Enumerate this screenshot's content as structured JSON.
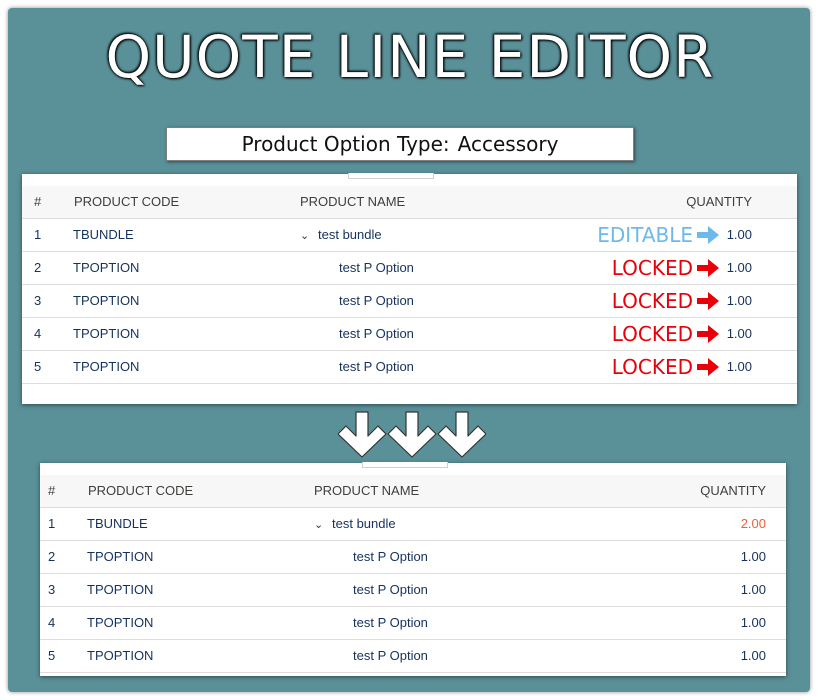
{
  "title": "QUOTE LINE EDITOR",
  "option_type": {
    "label": "Product Option Type:",
    "value": "Accessory"
  },
  "columns": {
    "num": "#",
    "code": "PRODUCT CODE",
    "name": "PRODUCT NAME",
    "qty": "QUANTITY"
  },
  "before": {
    "rows": [
      {
        "num": "1",
        "code": "TBUNDLE",
        "name": "test bundle",
        "qty": "1.00",
        "status": "EDITABLE"
      },
      {
        "num": "2",
        "code": "TPOPTION",
        "name": "test P Option",
        "qty": "1.00",
        "status": "LOCKED"
      },
      {
        "num": "3",
        "code": "TPOPTION",
        "name": "test P Option",
        "qty": "1.00",
        "status": "LOCKED"
      },
      {
        "num": "4",
        "code": "TPOPTION",
        "name": "test P Option",
        "qty": "1.00",
        "status": "LOCKED"
      },
      {
        "num": "5",
        "code": "TPOPTION",
        "name": "test P Option",
        "qty": "1.00",
        "status": "LOCKED"
      }
    ]
  },
  "after": {
    "rows": [
      {
        "num": "1",
        "code": "TBUNDLE",
        "name": "test bundle",
        "qty": "2.00"
      },
      {
        "num": "2",
        "code": "TPOPTION",
        "name": "test P Option",
        "qty": "1.00"
      },
      {
        "num": "3",
        "code": "TPOPTION",
        "name": "test P Option",
        "qty": "1.00"
      },
      {
        "num": "4",
        "code": "TPOPTION",
        "name": "test P Option",
        "qty": "1.00"
      },
      {
        "num": "5",
        "code": "TPOPTION",
        "name": "test P Option",
        "qty": "1.00"
      }
    ]
  },
  "colors": {
    "background": "#5a9098",
    "editable": "#6db9ec",
    "locked": "#e8000b",
    "changed_qty": "#e8613a"
  },
  "icons": {
    "expand": "chevron-down-icon",
    "status_arrow": "arrow-right-icon",
    "transition": "arrow-down-icon"
  }
}
